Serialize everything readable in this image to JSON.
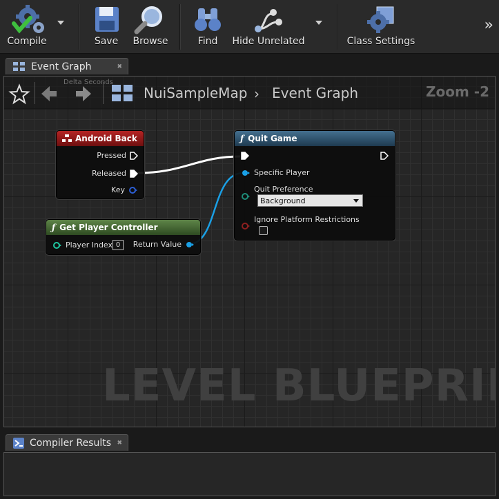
{
  "toolbar": {
    "compile_label": "Compile",
    "save_label": "Save",
    "browse_label": "Browse",
    "find_label": "Find",
    "hide_unrelated_label": "Hide Unrelated",
    "class_settings_label": "Class Settings",
    "more_label": "»"
  },
  "tabs": {
    "event_graph": "Event Graph",
    "compiler_results": "Compiler Results"
  },
  "graph": {
    "delta_seconds": "Delta Seconds",
    "breadcrumb_map": "NuiSampleMap",
    "breadcrumb_separator": "›",
    "breadcrumb_graph": "Event Graph",
    "zoom": "Zoom -2",
    "watermark": "LEVEL BLUEPRINT"
  },
  "nodes": {
    "android_back": {
      "title": "Android Back",
      "pins": {
        "pressed": "Pressed",
        "released": "Released",
        "key": "Key"
      }
    },
    "get_player_controller": {
      "title": "Get Player Controller",
      "player_index_label": "Player Index",
      "player_index_value": "0",
      "return_value": "Return Value"
    },
    "quit_game": {
      "title": "Quit Game",
      "specific_player": "Specific Player",
      "quit_preference": "Quit Preference",
      "quit_preference_value": "Background",
      "ignore_platform": "Ignore Platform Restrictions"
    }
  },
  "colors": {
    "event_header": "#9c1c1c",
    "function_header": "#34556e",
    "pure_header": "#4e6e3b",
    "object_pin": "#1aa0e6",
    "int_pin": "#1fc7a0",
    "bool_pin": "#8c1f1f",
    "key_pin": "#2c5fd6",
    "exec_wire": "#ffffff"
  }
}
